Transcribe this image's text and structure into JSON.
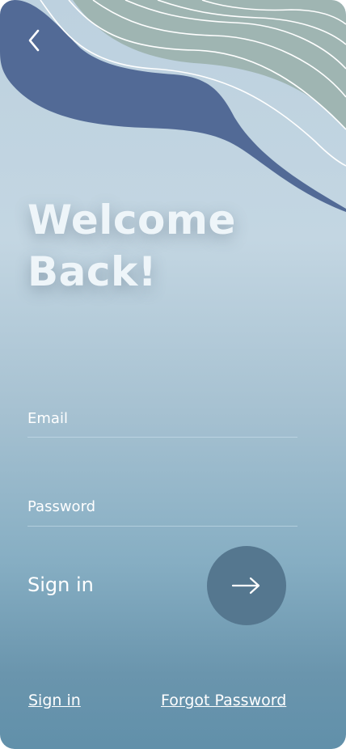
{
  "header": {
    "back_icon": "chevron-left-icon",
    "title_line1": "Welcome",
    "title_line2": "Back!"
  },
  "form": {
    "email_placeholder": "Email",
    "email_value": "",
    "password_placeholder": "Password",
    "password_value": "",
    "submit_label": "Sign in",
    "submit_icon": "arrow-right-icon"
  },
  "footer": {
    "sign_in_link": "Sign in",
    "forgot_password_link": "Forgot Password"
  },
  "colors": {
    "background_top": "#bdd1df",
    "background_bottom": "#6190aa",
    "wave_dark": "#526a96",
    "wave_light": "#9fb5b2",
    "button": "#55778f",
    "text": "#ffffff"
  }
}
